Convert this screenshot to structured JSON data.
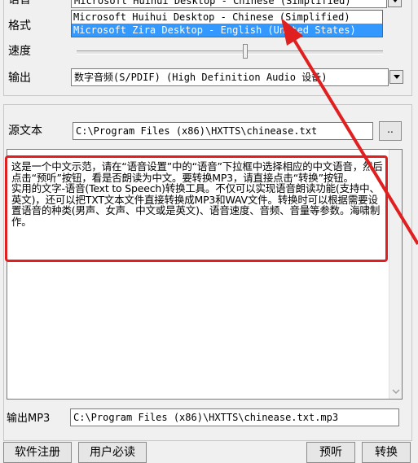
{
  "settings": {
    "voice_label": "语音",
    "voice_value": "Microsoft Huihui Desktop - Chinese (Simplified)",
    "voice_options": [
      "Microsoft Huihui Desktop - Chinese (Simplified)",
      "Microsoft Zira Desktop - English (United States)"
    ],
    "format_label": "格式",
    "speed_label": "速度",
    "speed_level": 0.55,
    "output_label": "输出",
    "output_value": "数字音频(S/PDIF) (High Definition Audio 设备)"
  },
  "source": {
    "label": "源文本",
    "path": "C:\\Program Files (x86)\\HXTTS\\chinease.txt",
    "browse_label": "..",
    "text": "这是一个中文示范，请在“语音设置”中的“语音”下拉框中选择相应的中文语音，然后点击“预听”按钮，看是否朗读为中文。要转换MP3，请直接点击“转换”按钮。\n实用的文字-语音(Text to Speech)转换工具。不仅可以实现语音朗读功能(支持中、英文)，还可以把TXT文本文件直接转换成MP3和WAV文件。转换时可以根据需要设置语音的种类(男声、女声、中文或是英文)、语音速度、音频、音量等参数。海啸制作。"
  },
  "output_mp3": {
    "label": "输出MP3",
    "path": "C:\\Program Files (x86)\\HXTTS\\chinease.txt.mp3"
  },
  "buttons": {
    "register": "软件注册",
    "must_read": "用户必读",
    "preview": "预听",
    "convert": "转换"
  },
  "colors": {
    "highlight": "#3399ff",
    "annotation_red": "#e02020"
  }
}
